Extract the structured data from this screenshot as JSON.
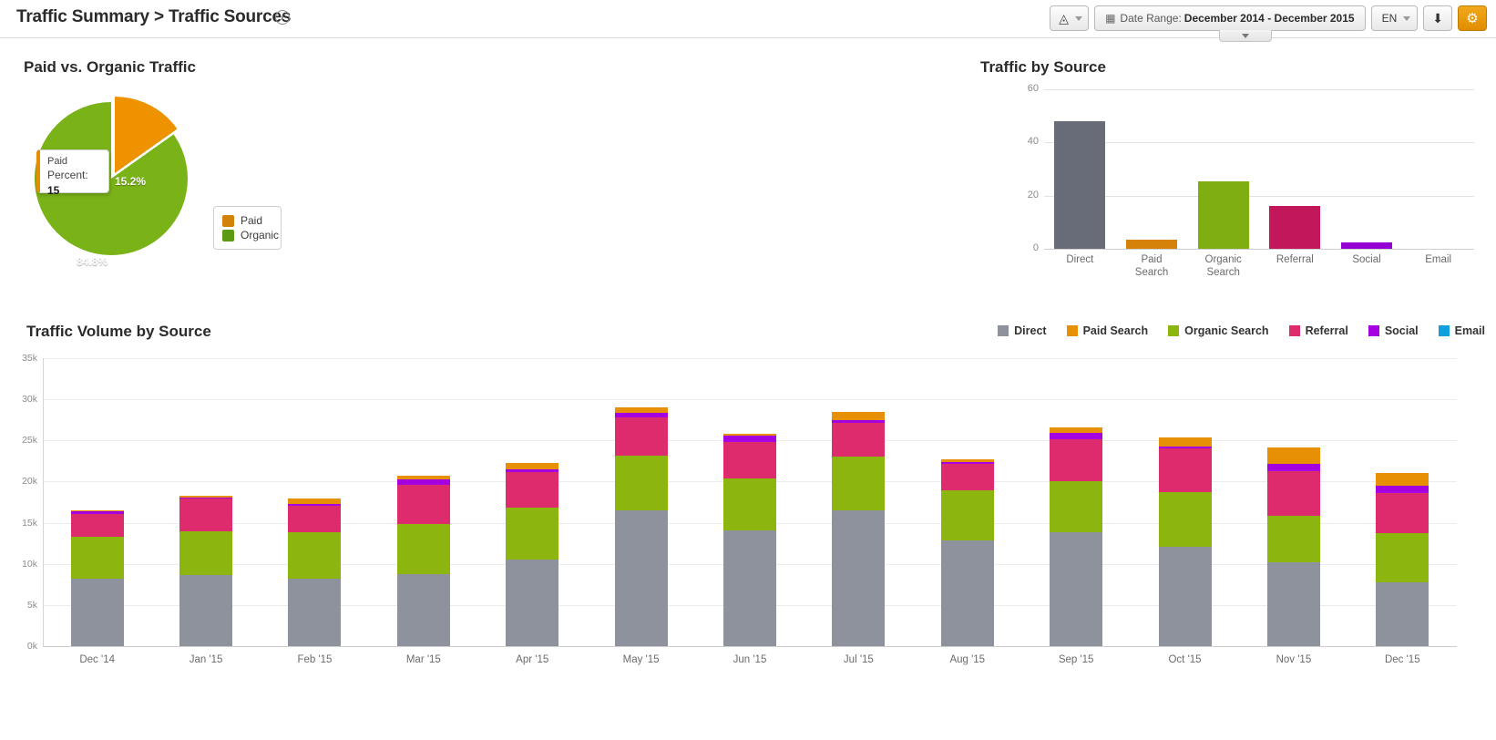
{
  "header": {
    "title": "Traffic Summary > Traffic Sources",
    "info_icon": "info-icon",
    "toolbar": {
      "cube_icon": "cube-icon",
      "calendar_icon": "calendar-icon",
      "date_range_label": "Date Range:",
      "date_range_value": "December 2014 - December 2015",
      "language": "EN",
      "download_icon": "download-icon",
      "gear_icon": "gear-icon"
    }
  },
  "colors": {
    "direct": "#8d929d",
    "paid_search": "#e89005",
    "organic_search": "#8cb60f",
    "referral": "#dd2b6d",
    "social": "#a400e0",
    "email": "#119fdd",
    "pie_paid": "#ef9200",
    "pie_organic": "#7ab317",
    "accent": "#e8a317"
  },
  "pie_panel": {
    "title": "Paid vs. Organic Traffic",
    "tooltip": {
      "name": "Paid",
      "metric": "Percent:",
      "value": "15"
    },
    "legend": [
      {
        "label": "Paid",
        "color": "#d2820a"
      },
      {
        "label": "Organic",
        "color": "#5c9a14"
      }
    ],
    "chart_data": {
      "type": "pie",
      "title": "Paid vs. Organic Traffic",
      "labels": [
        "Paid",
        "Organic"
      ],
      "values": [
        15.2,
        84.8
      ],
      "value_labels": [
        "15.2%",
        "84.8%"
      ],
      "colors": [
        "#ef9200",
        "#7ab317"
      ],
      "legend_position": "right",
      "exploded_slice": "Paid"
    }
  },
  "traffic_by_source": {
    "title": "Traffic by Source",
    "chart_data": {
      "type": "bar",
      "title": "Traffic by Source",
      "categories": [
        "Direct",
        "Paid Search",
        "Organic Search",
        "Referral",
        "Social",
        "Email"
      ],
      "category_lines": [
        [
          "Direct"
        ],
        [
          "Paid",
          "Search"
        ],
        [
          "Organic",
          "Search"
        ],
        [
          "Referral"
        ],
        [
          "Social"
        ],
        [
          "Email"
        ]
      ],
      "values": [
        48,
        3.5,
        25.5,
        16,
        2.5,
        0
      ],
      "colors": [
        "#676c78",
        "#d4820a",
        "#7fae12",
        "#c2185b",
        "#9400d3",
        "#119fdd"
      ],
      "xlabel": "",
      "ylabel": "",
      "ylim": [
        0,
        60
      ],
      "yticks": [
        0,
        20,
        40,
        60
      ],
      "ytick_labels": [
        "0",
        "20",
        "40",
        "60"
      ],
      "grid": true
    }
  },
  "traffic_volume": {
    "title": "Traffic Volume by Source",
    "legend": [
      {
        "label": "Direct",
        "color": "#8d929d"
      },
      {
        "label": "Paid Search",
        "color": "#e89005"
      },
      {
        "label": "Organic Search",
        "color": "#8cb60f"
      },
      {
        "label": "Referral",
        "color": "#dd2b6d"
      },
      {
        "label": "Social",
        "color": "#a400e0"
      },
      {
        "label": "Email",
        "color": "#119fdd"
      }
    ],
    "chart_data": {
      "type": "bar",
      "subtype": "stacked",
      "title": "Traffic Volume by Source",
      "categories": [
        "Dec '14",
        "Jan '15",
        "Feb '15",
        "Mar '15",
        "Apr '15",
        "May '15",
        "Jun '15",
        "Jul '15",
        "Aug '15",
        "Sep '15",
        "Oct '15",
        "Nov '15",
        "Dec '15"
      ],
      "stack_order": [
        "Direct",
        "Organic Search",
        "Referral",
        "Social",
        "Paid Search"
      ],
      "series": [
        {
          "name": "Direct",
          "color": "#8d929d",
          "values": [
            8200,
            8600,
            8200,
            8800,
            10500,
            16500,
            14100,
            16500,
            12900,
            13800,
            12100,
            10200,
            7700
          ]
        },
        {
          "name": "Organic Search",
          "color": "#8cb60f",
          "values": [
            5100,
            5400,
            5600,
            6100,
            6300,
            6600,
            6300,
            6500,
            6000,
            6200,
            6600,
            5600,
            6000
          ]
        },
        {
          "name": "Referral",
          "color": "#dd2b6d",
          "values": [
            2800,
            3900,
            3300,
            4700,
            4400,
            4700,
            4400,
            4100,
            3300,
            5200,
            5300,
            5500,
            4900
          ]
        },
        {
          "name": "Social",
          "color": "#a400e0",
          "values": [
            250,
            200,
            200,
            700,
            250,
            600,
            800,
            400,
            200,
            700,
            300,
            900,
            900
          ]
        },
        {
          "name": "Paid Search",
          "color": "#e89005",
          "values": [
            120,
            150,
            700,
            400,
            800,
            600,
            200,
            1000,
            300,
            700,
            1100,
            2000,
            1600
          ]
        },
        {
          "name": "Email",
          "color": "#119fdd",
          "values": [
            0,
            0,
            0,
            0,
            0,
            0,
            0,
            0,
            0,
            0,
            0,
            0,
            0
          ]
        }
      ],
      "totals": [
        16470,
        18250,
        18000,
        20700,
        22250,
        29000,
        25800,
        28500,
        22700,
        26600,
        25400,
        24200,
        21100
      ],
      "xlabel": "",
      "ylabel": "",
      "ylim": [
        0,
        35000
      ],
      "yticks": [
        0,
        5000,
        10000,
        15000,
        20000,
        25000,
        30000,
        35000
      ],
      "ytick_labels": [
        "0k",
        "5k",
        "10k",
        "15k",
        "20k",
        "25k",
        "30k",
        "35k"
      ],
      "grid": true,
      "legend_position": "top-right"
    }
  }
}
